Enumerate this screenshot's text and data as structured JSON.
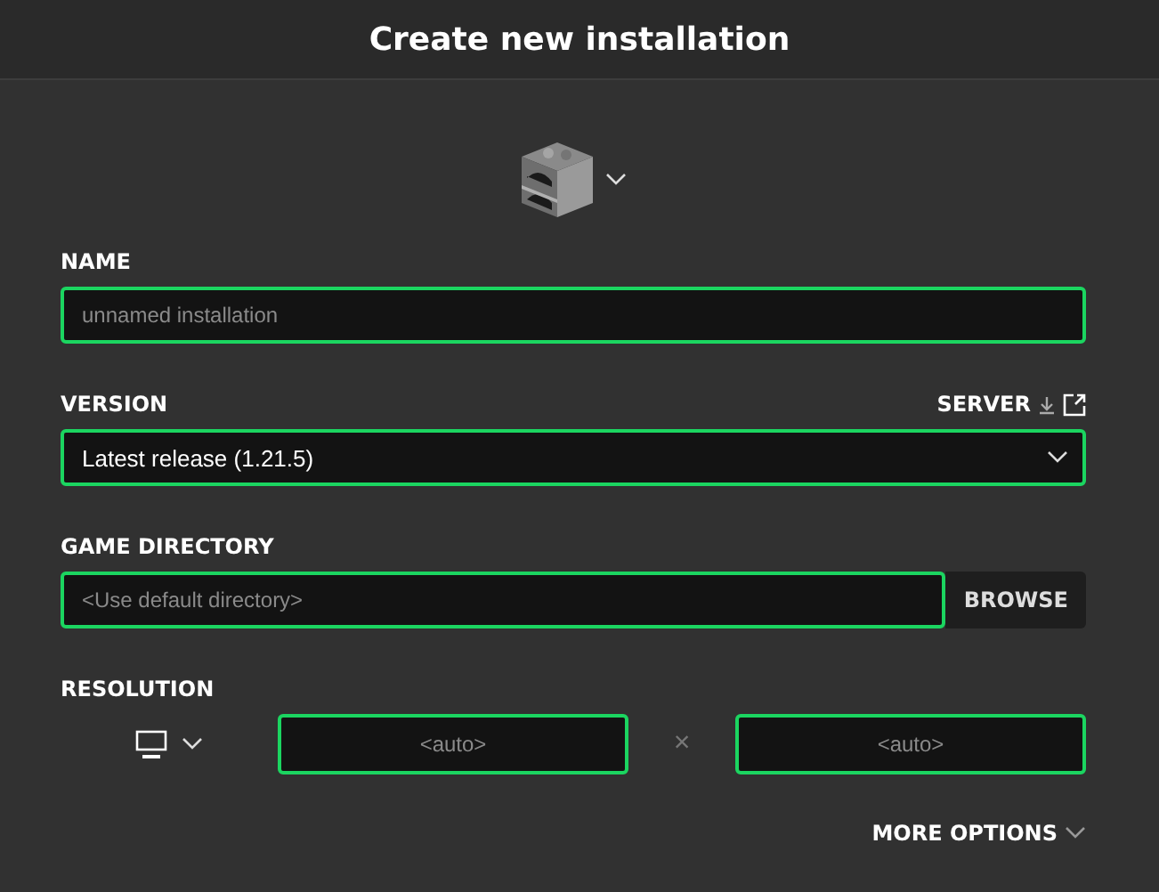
{
  "window": {
    "title": "Create new installation"
  },
  "icon_picker": {
    "expanded": false
  },
  "name": {
    "label": "NAME",
    "placeholder": "unnamed installation"
  },
  "version": {
    "label": "VERSION",
    "value": "Latest release (1.21.5)",
    "server_link": "SERVER"
  },
  "game_directory": {
    "label": "GAME DIRECTORY",
    "placeholder": "<Use default directory>",
    "button": "BROWSE"
  },
  "resolution": {
    "label": "RESOLUTION",
    "width_placeholder": "<auto>",
    "separator": "×",
    "height_placeholder": "<auto>"
  },
  "more_options": {
    "label": "MORE OPTIONS",
    "expanded": false
  }
}
